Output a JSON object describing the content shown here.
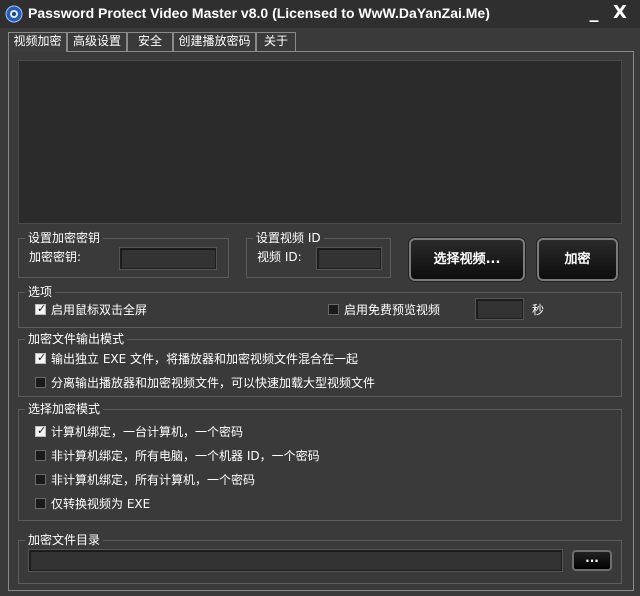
{
  "window": {
    "title": "Password Protect Video Master v8.0 (Licensed to WwW.DaYanZai.Me)",
    "minimize_label": "_",
    "close_label": "X"
  },
  "tabs": [
    {
      "label": "视频加密",
      "active": true
    },
    {
      "label": "高级设置",
      "active": false
    },
    {
      "label": "安全",
      "active": false
    },
    {
      "label": "创建播放密码",
      "active": false
    },
    {
      "label": "关于",
      "active": false
    }
  ],
  "encryption_key": {
    "group_title": "设置加密密钥",
    "label": "加密密钥:",
    "value": ""
  },
  "video_id": {
    "group_title": "设置视频 ID",
    "label": "视频 ID:",
    "value": ""
  },
  "buttons": {
    "select_video": "选择视频...",
    "encrypt": "加密",
    "browse": "..."
  },
  "options": {
    "group_title": "选项",
    "fullscreen_label": "启用鼠标双击全屏",
    "fullscreen_checked": true,
    "free_preview_label": "启用免费预览视频",
    "free_preview_checked": false,
    "preview_seconds": "",
    "seconds_unit": "秒"
  },
  "output_mode": {
    "group_title": "加密文件输出模式",
    "items": [
      {
        "label": "输出独立 EXE 文件，将播放器和加密视频文件混合在一起",
        "checked": true
      },
      {
        "label": "分离输出播放器和加密视频文件，可以快速加载大型视频文件",
        "checked": false
      }
    ]
  },
  "encrypt_mode": {
    "group_title": "选择加密模式",
    "items": [
      {
        "label": "计算机绑定，一台计算机，一个密码",
        "checked": true
      },
      {
        "label": "非计算机绑定，所有电脑，一个机器 ID，一个密码",
        "checked": false
      },
      {
        "label": "非计算机绑定，所有计算机，一个密码",
        "checked": false
      },
      {
        "label": "仅转换视频为 EXE",
        "checked": false
      }
    ]
  },
  "output_dir": {
    "group_title": "加密文件目录",
    "value": ""
  }
}
